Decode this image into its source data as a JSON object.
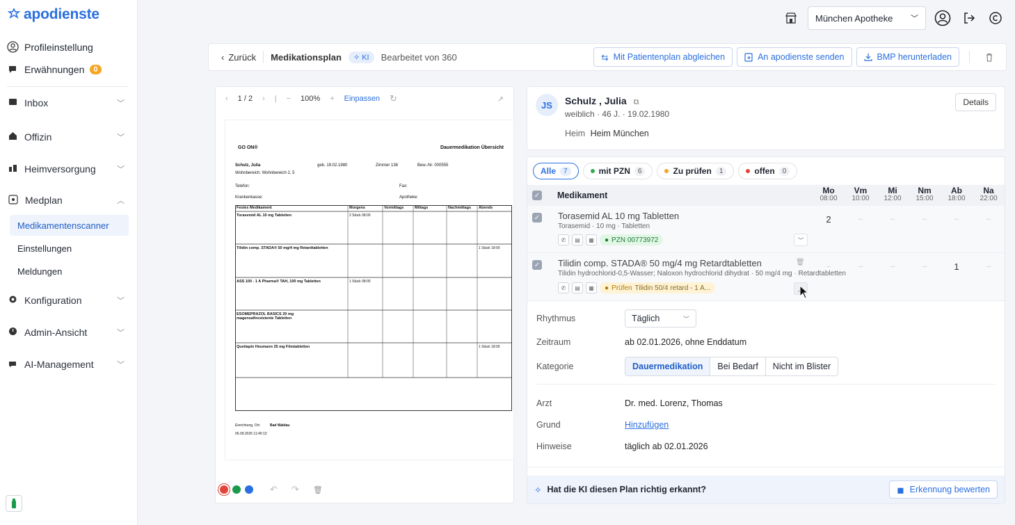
{
  "brand": {
    "name": "apodienste"
  },
  "sidebar": {
    "profile": "Profileinstellung",
    "mentions": "Erwähnungen",
    "mentions_count": "0",
    "nav": [
      {
        "label": "Inbox",
        "icon": "inbox-icon"
      },
      {
        "label": "Offizin",
        "icon": "store-icon"
      },
      {
        "label": "Heimversorgung",
        "icon": "care-home-icon"
      },
      {
        "label": "Medplan",
        "icon": "medplan-icon"
      },
      {
        "label": "Konfiguration",
        "icon": "gear-icon"
      },
      {
        "label": "Admin-Ansicht",
        "icon": "admin-icon"
      },
      {
        "label": "AI-Management",
        "icon": "ai-icon"
      }
    ],
    "sub": [
      "Medikamentenscanner",
      "Einstellungen",
      "Meldungen"
    ]
  },
  "header": {
    "pharmacy": "München Apotheke"
  },
  "toolbar": {
    "back": "Zurück",
    "title": "Medikationsplan",
    "ki": "KI",
    "edited": "Bearbeitet von 360",
    "btn_compare": "Mit Patientenplan abgleichen",
    "btn_send": "An apodienste senden",
    "btn_download": "BMP herunterladen"
  },
  "viewer": {
    "page": "1 / 2",
    "zoom": "100%",
    "fit": "Einpassen",
    "doc": {
      "brand": "GO ON®",
      "heading": "Dauermedikation Übersicht",
      "patient": "Schulz, Julia",
      "dob": "geb. 19.02.1980",
      "room": "Zimmer 138",
      "resident": "Bew.-Nr. 000555",
      "area": "Wohnbereich: Wohnbereich 2, 5",
      "phone": "Telefon:",
      "fax": "Fax:",
      "insurer": "Krankenkasse:",
      "pharmacy": "Apotheke:",
      "cols": [
        "Festes Medikament",
        "Morgens",
        "Vormittags",
        "Mittags",
        "Nachmittags",
        "Abends"
      ],
      "rows": [
        {
          "name": "Torasemid AL 10 mg Tabletten",
          "dose": "2 Stück 08:00"
        },
        {
          "name": "Tilidin comp. STADA® 50 mg/4 mg Retardtabletten",
          "dose": "1 Stück 18:00"
        },
        {
          "name": "ASS 100 - 1 A Pharma® TAH, 100 mg Tabletten",
          "dose": "1 Stück 08:00"
        },
        {
          "name": "ESOMEPRAZOL BASICS 20 mg magensaftresistente Tabletten",
          "dose": ""
        },
        {
          "name": "Quetiapin Heumann 25 mg Filmtabletten",
          "dose": "1 Stück 18:00"
        }
      ],
      "footer_place": "Einrichtung, Ort:",
      "footer_name": "Bad Waldau",
      "footer_date": "06.09.2026 11:40:13"
    }
  },
  "patient": {
    "initials": "JS",
    "name": "Schulz , Julia",
    "meta": "weiblich · 46 J. · 19.02.1980",
    "heim_label": "Heim",
    "heim": "Heim München",
    "details": "Details"
  },
  "filters": [
    {
      "label": "Alle",
      "count": "7",
      "color": "",
      "active": true
    },
    {
      "label": "mit PZN",
      "count": "6",
      "color": "#34a853"
    },
    {
      "label": "Zu prüfen",
      "count": "1",
      "color": "#f5a623"
    },
    {
      "label": "offen",
      "count": "0",
      "color": "#e0453a"
    }
  ],
  "table": {
    "header": "Medikament",
    "times": [
      {
        "day": "Mo",
        "time": "08:00"
      },
      {
        "day": "Vm",
        "time": "10:00"
      },
      {
        "day": "Mi",
        "time": "12:00"
      },
      {
        "day": "Nm",
        "time": "15:00"
      },
      {
        "day": "Ab",
        "time": "18:00"
      },
      {
        "day": "Na",
        "time": "22:00"
      }
    ],
    "rows": [
      {
        "name": "Torasemid AL 10 mg Tabletten",
        "sub": "Torasemid · 10 mg · Tabletten",
        "tag": "PZN 00773972",
        "doses": [
          "2",
          "–",
          "–",
          "–",
          "–",
          "–"
        ]
      },
      {
        "name": "Tilidin comp. STADA® 50 mg/4 mg Retardtabletten",
        "sub": "Tilidin hydrochlorid-0,5-Wasser; Naloxon hydrochlorid dihydrat · 50 mg/4 mg · Retardtabletten",
        "tag": "Prüfen",
        "tag_detail": "Tilidin 50/4 retard - 1 A...",
        "doses": [
          "–",
          "–",
          "–",
          "–",
          "1",
          "–"
        ]
      }
    ]
  },
  "detail": {
    "rhythm_label": "Rhythmus",
    "rhythm": "Täglich",
    "period_label": "Zeitraum",
    "period": "ab 02.01.2026, ohne Enddatum",
    "category_label": "Kategorie",
    "categories": [
      "Dauermedikation",
      "Bei Bedarf",
      "Nicht im Blister"
    ],
    "doctor_label": "Arzt",
    "doctor": "Dr. med. Lorenz, Thomas",
    "reason_label": "Grund",
    "reason": "Hinzufügen",
    "notes_label": "Hinweise",
    "notes": "täglich ab 02.01.2026"
  },
  "footer": {
    "question": "Hat die KI diesen Plan richtig erkannt?",
    "rate": "Erkennung bewerten"
  }
}
